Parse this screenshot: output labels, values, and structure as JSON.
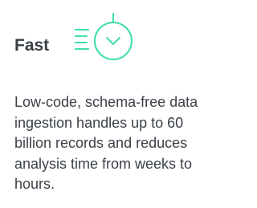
{
  "feature": {
    "title": "Fast",
    "icon": "stopwatch-speed-icon",
    "accent_color": "#3ee0a6",
    "description": "Low-code, schema-free data ingestion handles up to 60 billion records and reduces analysis time from weeks to hours."
  }
}
